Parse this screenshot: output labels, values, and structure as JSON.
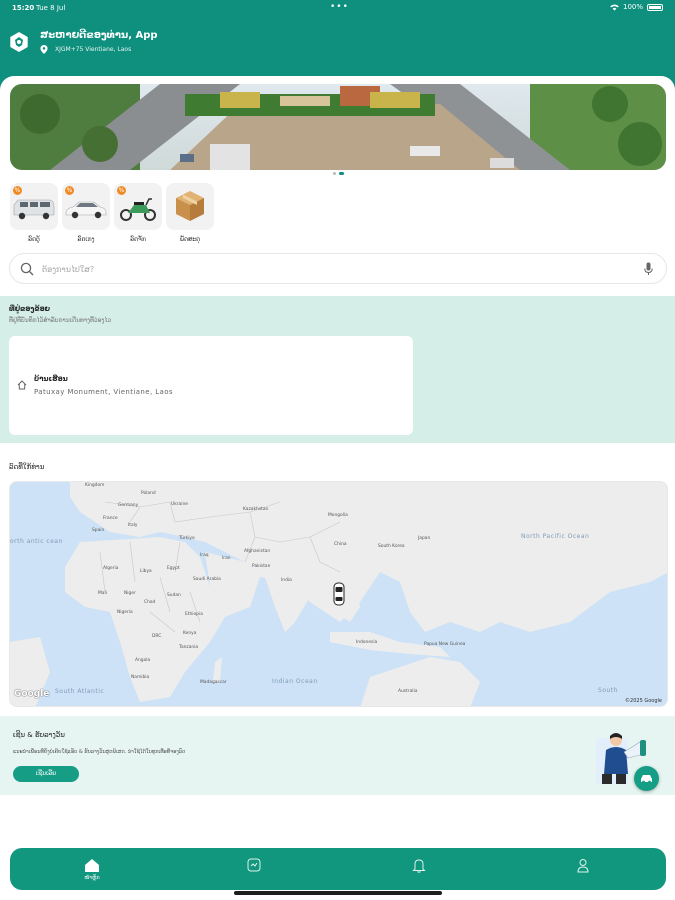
{
  "status_bar": {
    "time": "15:20",
    "date": "Tue 8 Jul",
    "battery": "100%"
  },
  "header": {
    "app_title": "ສະຫາຍດີ​ຂອງ​ທ່ານ, App",
    "location": "XJGM+75 Vientiane, Laos",
    "accent_color": "#0f8f7e"
  },
  "services": [
    {
      "label": "ລົດຕູ້",
      "icon": "van-icon"
    },
    {
      "label": "ລົດເກງ",
      "icon": "car-icon"
    },
    {
      "label": "ລົດຈັກ",
      "icon": "motorbike-icon"
    },
    {
      "label": "ພັດສະດຸ",
      "icon": "parcel-icon"
    }
  ],
  "search": {
    "placeholder": "ຕ້ອງການໄປໃສ?"
  },
  "saved_places": {
    "title": "ທີ່ຢູ່ຂອງຂ້ອຍ",
    "subtitle": "ທີ່ຢູ່ທີ່ບັນທຶກໄວ້ສໍາລັບການເດີນທາງທີ່ວ່ອງໄວ",
    "items": [
      {
        "name": "ບ້ານເຮືອນ",
        "address": "Patuxay Monument, Vientiane, Laos"
      }
    ]
  },
  "map": {
    "title": "ລົດທີ່ໃກ້ທ່ານ",
    "labels": {
      "kingdom": "Kingdom",
      "poland": "Poland",
      "ukraine": "Ukraine",
      "germany": "Germany",
      "france": "France",
      "italy": "Italy",
      "spain": "Spain",
      "turkiye": "Türkiye",
      "kazakhstan": "Kazakhstan",
      "mongolia": "Mongolia",
      "china": "China",
      "south_korea": "South Korea",
      "japan": "Japan",
      "iraq": "Iraq",
      "iran": "Iran",
      "afghanistan": "Afghanistan",
      "pakistan": "Pakistan",
      "india": "India",
      "algeria": "Algeria",
      "libya": "Libya",
      "egypt": "Egypt",
      "saudi_arabia": "Saudi Arabia",
      "mali": "Mali",
      "niger": "Niger",
      "chad": "Chad",
      "sudan": "Sudan",
      "nigeria": "Nigeria",
      "ethiopia": "Ethiopia",
      "drc": "DRC",
      "kenya": "Kenya",
      "tanzania": "Tanzania",
      "angola": "Angola",
      "namibia": "Namibia",
      "madagascar": "Madagascar",
      "indonesia": "Indonesia",
      "papua": "Papua New Guinea",
      "australia": "Australia"
    },
    "oceans": {
      "north_pacific": "North Pacific Ocean",
      "north_atlantic": "orth antic cean",
      "indian": "Indian Ocean",
      "south_atlantic": "South Atlantic",
      "south_pacific": "South"
    },
    "google_logo": "Google",
    "copyright": "©2025 Google"
  },
  "promo": {
    "title": "ເຊີນ & ຮັບລາງວັນ",
    "text": "ແນະນໍາເພື່ອນທີ່ຍັງບໍ່ເຄີຍໃຊ້ແອັບ & ຮັບລາງວັນສຸດພິເສດ. ນໍາໃຊ້ໄດ້ໃນທຸກເທື່ອທີ່ຈອງລົດ",
    "button": "ເຊີນເລີຍ"
  },
  "bottom_nav": [
    {
      "label": "ໜ້າຫຼັກ",
      "icon": "home-icon",
      "active": true
    },
    {
      "label": "",
      "icon": "chat-icon",
      "active": false
    },
    {
      "label": "",
      "icon": "bell-icon",
      "active": false
    },
    {
      "label": "",
      "icon": "profile-icon",
      "active": false
    }
  ]
}
